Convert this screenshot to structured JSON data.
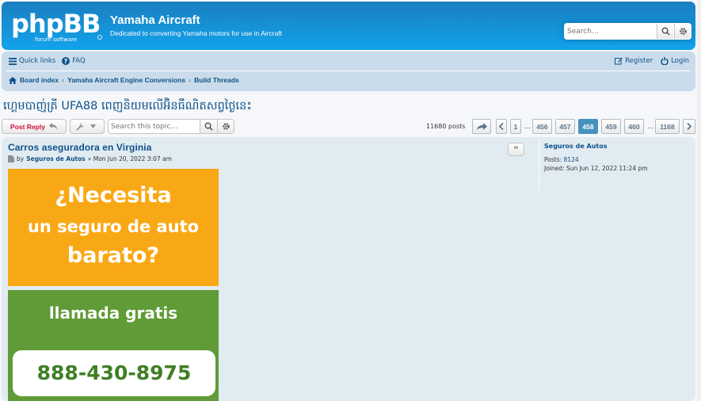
{
  "header": {
    "logo_text": "phpBB",
    "logo_sub": "forum software",
    "site_title": "Yamaha Aircraft",
    "site_description": "Dedicated to converting Yamaha motors for use in Aircraft",
    "search_placeholder": "Search…"
  },
  "navbar": {
    "quick_links": "Quick links",
    "faq": "FAQ",
    "register": "Register",
    "login": "Login",
    "breadcrumbs": [
      "Board index",
      "Yamaha Aircraft Engine Conversions",
      "Build Threads"
    ]
  },
  "topic": {
    "title": "ហ្គេមបាញ់ត្រី UFA88 ពេញនិយមលើអ៊ិនធឺណិតសព្វថ្ងៃនេះ",
    "post_reply": "Post Reply",
    "search_placeholder": "Search this topic…",
    "post_count": "11680 posts",
    "pages": {
      "first": "1",
      "ellipsis": "…",
      "middle": [
        "456",
        "457",
        "458",
        "459",
        "460"
      ],
      "current": "458",
      "last": "1168"
    }
  },
  "post": {
    "title": "Carros aseguradora en Virginia",
    "by": "by",
    "author": "Seguros de Autos",
    "date": "» Mon Jun 20, 2022 3:07 am",
    "quote_symbol": "❝",
    "profile": {
      "username": "Seguros de Autos",
      "posts_label": "Posts:",
      "posts_value": "8124",
      "joined_label": "Joined:",
      "joined_value": "Sun Jun 12, 2022 11:24 pm"
    },
    "ad": {
      "line1": "¿Necesita",
      "line2": "un seguro de auto",
      "line3": "barato?",
      "line4": "llamada gratis",
      "phone": "888-430-8975"
    }
  },
  "colors": {
    "header_from": "#1a7ec0",
    "header_to": "#12a3eb",
    "navbar": "#cadceb",
    "post_bg": "#e1ebf2",
    "link": "#105289",
    "reply": "#d31141",
    "active_page": "#4692bf",
    "ad_orange": "#f9a815",
    "ad_green": "#5f9b36"
  }
}
